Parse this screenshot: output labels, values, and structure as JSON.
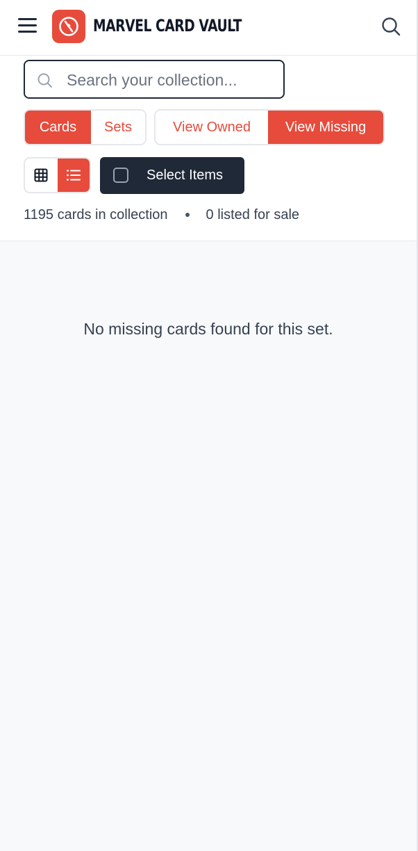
{
  "header": {
    "brand_title": "MARVEL CARD VAULT",
    "accent_color": "#e64b3c",
    "menu_icon": "hamburger-menu-icon",
    "logo_icon": "card-vault-logo-icon",
    "search_icon": "search-icon"
  },
  "search": {
    "placeholder": "Search your collection...",
    "value": ""
  },
  "tabs": {
    "type": [
      {
        "label": "Cards",
        "active": true
      },
      {
        "label": "Sets",
        "active": false
      }
    ],
    "view": [
      {
        "label": "View Owned",
        "active": false
      },
      {
        "label": "View Missing",
        "active": true
      }
    ],
    "layout": [
      {
        "icon": "grid-view-icon",
        "active": false
      },
      {
        "icon": "list-view-icon",
        "active": true
      }
    ]
  },
  "select_items": {
    "label": "Select Items",
    "checked": false
  },
  "stats": {
    "cards_text": "1195 cards in collection",
    "listed_text": "0 listed for sale"
  },
  "empty_state": {
    "message": "No missing cards found for this set."
  }
}
